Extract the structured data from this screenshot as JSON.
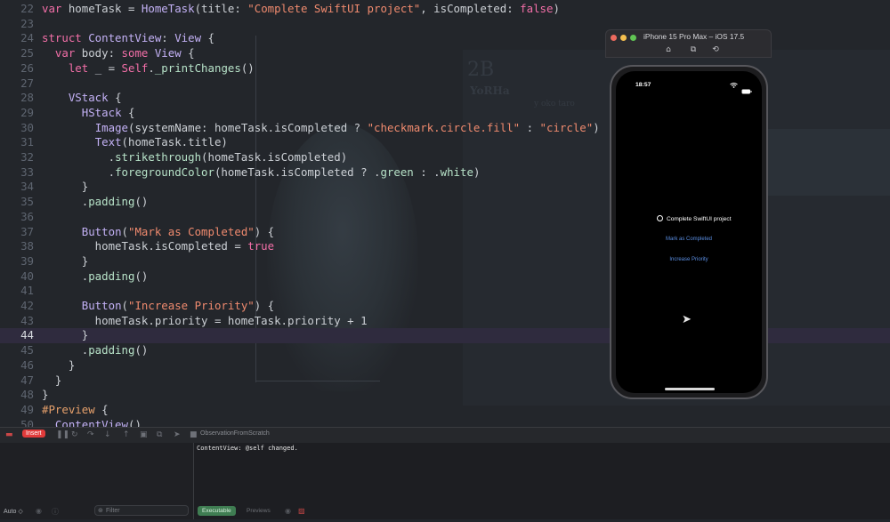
{
  "editor": {
    "current_line": 44,
    "lines": [
      {
        "n": "22",
        "segs": [
          {
            "t": "var ",
            "c": "kw"
          },
          {
            "t": "homeTask = "
          },
          {
            "t": "HomeTask",
            "c": "ty"
          },
          {
            "t": "(title: "
          },
          {
            "t": "\"Complete SwiftUI project\"",
            "c": "str"
          },
          {
            "t": ", isCompleted: "
          },
          {
            "t": "false",
            "c": "kw"
          },
          {
            "t": ")"
          }
        ]
      },
      {
        "n": "23",
        "segs": []
      },
      {
        "n": "24",
        "segs": [
          {
            "t": "struct ",
            "c": "kw"
          },
          {
            "t": "ContentView",
            "c": "ty"
          },
          {
            "t": ": "
          },
          {
            "t": "View",
            "c": "ty"
          },
          {
            "t": " {"
          }
        ]
      },
      {
        "n": "25",
        "segs": [
          {
            "t": "  "
          },
          {
            "t": "var ",
            "c": "kw"
          },
          {
            "t": "body: "
          },
          {
            "t": "some ",
            "c": "kw"
          },
          {
            "t": "View",
            "c": "ty"
          },
          {
            "t": " {"
          }
        ]
      },
      {
        "n": "26",
        "segs": [
          {
            "t": "    "
          },
          {
            "t": "let ",
            "c": "kw"
          },
          {
            "t": "_ = "
          },
          {
            "t": "Self",
            "c": "kw"
          },
          {
            "t": "."
          },
          {
            "t": "_printChanges",
            "c": "fn"
          },
          {
            "t": "()"
          }
        ]
      },
      {
        "n": "27",
        "segs": []
      },
      {
        "n": "28",
        "segs": [
          {
            "t": "    "
          },
          {
            "t": "VStack",
            "c": "ty"
          },
          {
            "t": " {"
          }
        ]
      },
      {
        "n": "29",
        "segs": [
          {
            "t": "      "
          },
          {
            "t": "HStack",
            "c": "ty"
          },
          {
            "t": " {"
          }
        ]
      },
      {
        "n": "30",
        "segs": [
          {
            "t": "        "
          },
          {
            "t": "Image",
            "c": "ty"
          },
          {
            "t": "(systemName: homeTask.isCompleted ? "
          },
          {
            "t": "\"checkmark.circle.fill\"",
            "c": "str"
          },
          {
            "t": " : "
          },
          {
            "t": "\"circle\"",
            "c": "str"
          },
          {
            "t": ")"
          }
        ]
      },
      {
        "n": "31",
        "segs": [
          {
            "t": "        "
          },
          {
            "t": "Text",
            "c": "ty"
          },
          {
            "t": "(homeTask.title)"
          }
        ]
      },
      {
        "n": "32",
        "segs": [
          {
            "t": "          ."
          },
          {
            "t": "strikethrough",
            "c": "fn"
          },
          {
            "t": "(homeTask.isCompleted)"
          }
        ]
      },
      {
        "n": "33",
        "segs": [
          {
            "t": "          ."
          },
          {
            "t": "foregroundColor",
            "c": "fn"
          },
          {
            "t": "(homeTask.isCompleted ? ."
          },
          {
            "t": "green",
            "c": "fn"
          },
          {
            "t": " : ."
          },
          {
            "t": "white",
            "c": "fn"
          },
          {
            "t": ")"
          }
        ]
      },
      {
        "n": "34",
        "segs": [
          {
            "t": "      }"
          }
        ]
      },
      {
        "n": "35",
        "segs": [
          {
            "t": "      ."
          },
          {
            "t": "padding",
            "c": "fn"
          },
          {
            "t": "()"
          }
        ]
      },
      {
        "n": "36",
        "segs": []
      },
      {
        "n": "37",
        "segs": [
          {
            "t": "      "
          },
          {
            "t": "Button",
            "c": "ty"
          },
          {
            "t": "("
          },
          {
            "t": "\"Mark as Completed\"",
            "c": "str"
          },
          {
            "t": ") {"
          }
        ]
      },
      {
        "n": "38",
        "segs": [
          {
            "t": "        homeTask.isCompleted = "
          },
          {
            "t": "true",
            "c": "kw"
          }
        ]
      },
      {
        "n": "39",
        "segs": [
          {
            "t": "      }"
          }
        ]
      },
      {
        "n": "40",
        "segs": [
          {
            "t": "      ."
          },
          {
            "t": "padding",
            "c": "fn"
          },
          {
            "t": "()"
          }
        ]
      },
      {
        "n": "41",
        "segs": []
      },
      {
        "n": "42",
        "segs": [
          {
            "t": "      "
          },
          {
            "t": "Button",
            "c": "ty"
          },
          {
            "t": "("
          },
          {
            "t": "\"Increase Priority\"",
            "c": "str"
          },
          {
            "t": ") {"
          }
        ]
      },
      {
        "n": "43",
        "segs": [
          {
            "t": "        homeTask.priority = homeTask.priority + 1"
          }
        ]
      },
      {
        "n": "44",
        "segs": [
          {
            "t": "      }"
          }
        ]
      },
      {
        "n": "45",
        "segs": [
          {
            "t": "      ."
          },
          {
            "t": "padding",
            "c": "fn"
          },
          {
            "t": "()"
          }
        ]
      },
      {
        "n": "46",
        "segs": [
          {
            "t": "    }"
          }
        ]
      },
      {
        "n": "47",
        "segs": [
          {
            "t": "  }"
          }
        ]
      },
      {
        "n": "48",
        "segs": [
          {
            "t": "}"
          }
        ]
      },
      {
        "n": "49",
        "segs": [
          {
            "t": "#Preview",
            "c": "pp"
          },
          {
            "t": " {"
          }
        ]
      },
      {
        "n": "50",
        "segs": [
          {
            "t": "  "
          },
          {
            "t": "ContentView",
            "c": "ty"
          },
          {
            "t": "()"
          }
        ]
      }
    ]
  },
  "background_art": {
    "title": "2B",
    "subtitle": "YoRHa",
    "small": "y oko taro"
  },
  "simulator": {
    "title": "iPhone 15 Pro Max – iOS 17.5",
    "buttons": [
      "home-icon",
      "screenshot-icon",
      "rotate-icon"
    ],
    "screen": {
      "time": "18:57",
      "task_title": "Complete SwiftUI project",
      "mark_button": "Mark as Completed",
      "priority_button": "Increase Priority"
    }
  },
  "debug_bar": {
    "insert_badge": "Insert",
    "scheme_name": "ObservationFromScratch"
  },
  "console": {
    "output": "ContentView: @self changed."
  },
  "footer": {
    "auto_label": "Auto ◇",
    "filter_placeholder": "Filter",
    "executable_label": "Executable",
    "previews_label": "Previews"
  },
  "colors": {
    "editor_bg": "#23262b",
    "keyword": "#f36fa8",
    "type": "#c3b1f5",
    "string": "#ef8a6e",
    "link_blue": "#5a8de0",
    "insert_red": "#e13b3b",
    "executable_green": "#3f7d52"
  }
}
